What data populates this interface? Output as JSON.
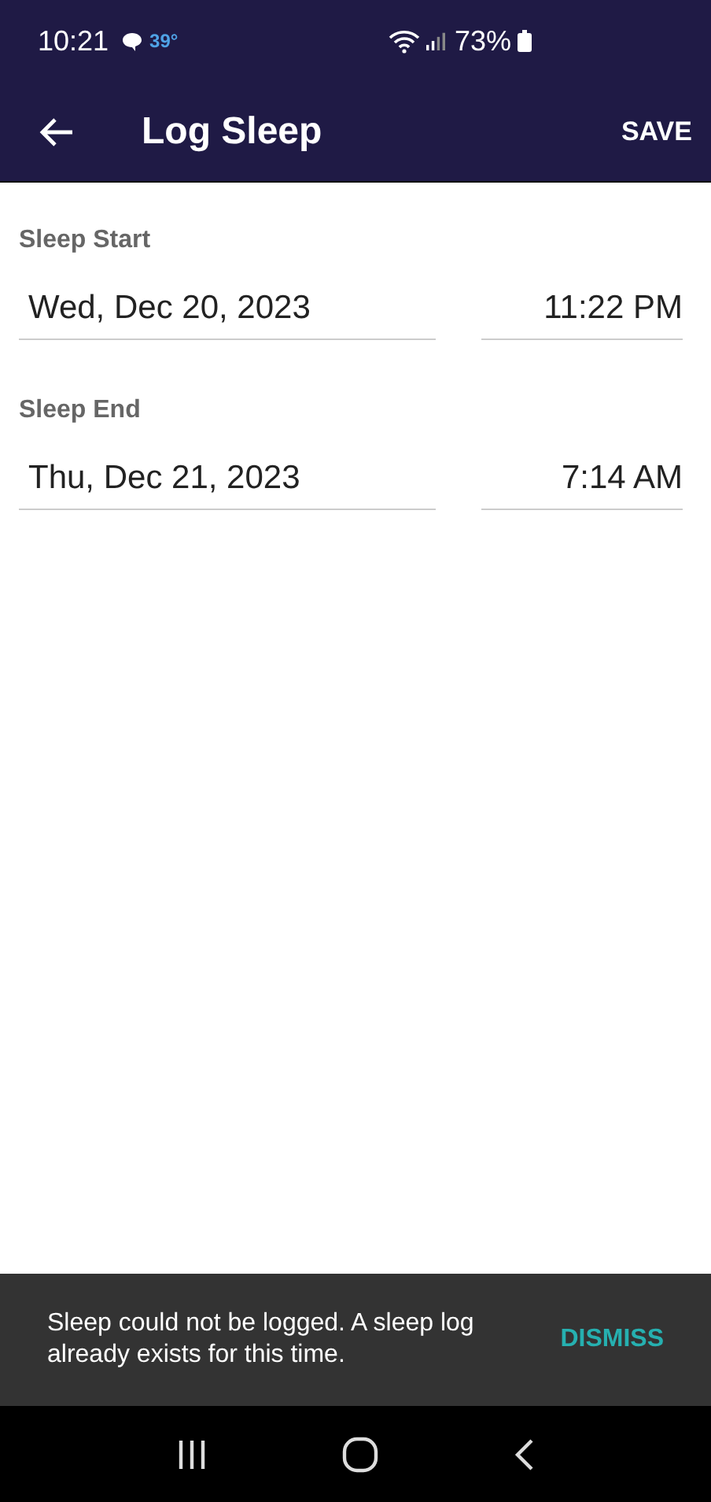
{
  "status_bar": {
    "time": "10:21",
    "temperature": "39°",
    "battery": "73%"
  },
  "app_bar": {
    "title": "Log Sleep",
    "action": "SAVE"
  },
  "sections": [
    {
      "label": "Sleep Start",
      "date": "Wed, Dec 20, 2023",
      "time": "11:22 PM"
    },
    {
      "label": "Sleep End",
      "date": "Thu, Dec 21, 2023",
      "time": "7:14 AM"
    }
  ],
  "snackbar": {
    "message": "Sleep could not be logged. A sleep log already exists for this time.",
    "action": "DISMISS"
  }
}
